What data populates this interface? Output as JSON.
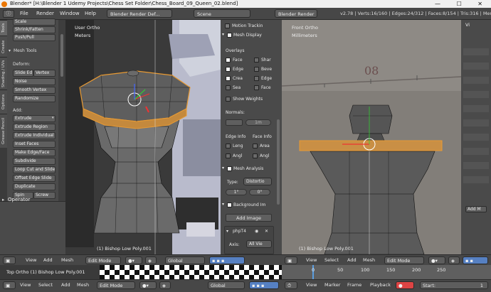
{
  "window": {
    "title": "Blender* [H:\\Blender 1 Udemy Projects\\Chess Set Folder\\Chess_Board_09_Queen_02.blend]",
    "controls": "— ☐ ✕"
  },
  "topbar": {
    "menus": [
      "File",
      "Render",
      "Window",
      "Help"
    ],
    "layout": "Blender Render Def...",
    "scene": "Scene",
    "engine": "Blender Render",
    "stats": "v2.78 | Verts:16/160 | Edges:24/312 | Faces:8/154 | Tris:316 | Mem"
  },
  "left_tabs": [
    "Tools",
    "Create",
    "Shading / UVs",
    "Options",
    "Grease Pencil"
  ],
  "tool_panel": {
    "top_items": [
      "Scale",
      "Shrink/Fatten",
      "Push/Pull"
    ],
    "section": "Mesh Tools",
    "deform_label": "Deform:",
    "deform": [
      "Slide Ed",
      "Vertex",
      "Noise",
      "Smooth Vertex",
      "Randomize"
    ],
    "add_label": "Add:",
    "add": [
      "Extrude",
      "Extrude Region",
      "Extrude Individual",
      "Inset Faces",
      "Make Edge/Face",
      "Subdivide",
      "Loop Cut and Slide",
      "Offset Edge Slide",
      "Duplicate",
      "Spin",
      "Screw"
    ],
    "operator": "Operator"
  },
  "viewport_left": {
    "view": "User Ortho",
    "units": "Meters",
    "object": "(1) Bishop Low Poly.001"
  },
  "properties": {
    "motion_tracking": "Motion Trackin",
    "mesh_display": "Mesh Display",
    "overlays": "Overlays",
    "overlay_items": [
      "Face",
      "Shar",
      "Edge",
      "Beve",
      "Crea",
      "Edge",
      "Sea",
      "Face"
    ],
    "show_weights": "Show Weights",
    "normals": "Normals:",
    "normal_size": "1m",
    "edge_info": "Edge Info",
    "face_info": "Face Info",
    "info_items": [
      "Leng",
      "Area",
      "Angl",
      "Angl"
    ],
    "mesh_analysis": "Mesh Analysis",
    "type_label": "Type:",
    "type_value": "Distortio",
    "angle_min": "1°",
    "angle_max": "0°",
    "background": "Background Im",
    "add_image": "Add Image",
    "image_name": "phpT4",
    "axis_label": "Axis:",
    "axis_value": "All Vie"
  },
  "viewport_right": {
    "view": "Front Ortho",
    "units": "Millimeters",
    "object": "(1) Bishop Low Poly.001",
    "ruler_text": "08"
  },
  "right_panel": {
    "tab": "Vi",
    "mode": "Add M"
  },
  "header_left": {
    "items": [
      "View",
      "Add",
      "Mesh"
    ],
    "mode": "Edit Mode",
    "pivot": "Global"
  },
  "header_right": {
    "items": [
      "View",
      "Select",
      "Add",
      "Mesh"
    ],
    "mode": "Edit Mode"
  },
  "strip_left": {
    "text": "Top Ortho (1) Bishop Low Poly.001"
  },
  "timeline": {
    "ticks": [
      "0",
      "50",
      "100",
      "150",
      "200",
      "250"
    ]
  },
  "bottom_left": {
    "items": [
      "View",
      "Select",
      "Add",
      "Mesh"
    ],
    "mode": "Edit Mode",
    "pivot": "Global"
  },
  "bottom_right": {
    "items": [
      "View",
      "Marker",
      "Frame",
      "Playback"
    ],
    "start_label": "Start:",
    "start_value": "1"
  },
  "colors": {
    "selected": "#e89a33",
    "header": "#474747",
    "panel": "#4a4a4a",
    "active_button": "#5680c2"
  }
}
